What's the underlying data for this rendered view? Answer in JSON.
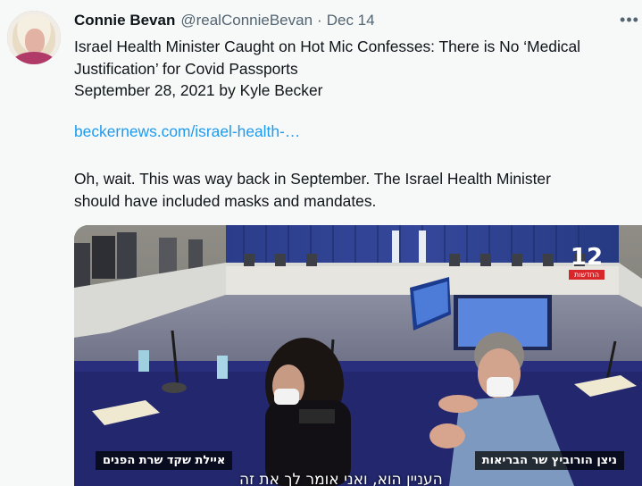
{
  "tweet": {
    "author": {
      "display_name": "Connie Bevan",
      "handle": "@realConnieBevan",
      "separator": "·",
      "date": "Dec 14"
    },
    "more_icon": "ellipsis-icon",
    "text_lines": [
      "Israel Health Minister Caught on Hot Mic Confesses: There is No ‘Medical",
      "Justification’ for Covid Passports",
      "September 28, 2021 by Kyle Becker"
    ],
    "link": "beckernews.com/israel-health-…",
    "text_after_link": [
      "Oh, wait. This was way back in September. The Israel Health Minister",
      "should have included masks and mandates."
    ]
  },
  "media": {
    "channel_number": "12",
    "channel_sub": "החדשות",
    "caption_left": "איילת שקד  שרת הפנים",
    "caption_right": "ניצן הורוביץ  שר הבריאות",
    "subtitle": "העניין הוא, ואני אומר לך את זה"
  }
}
